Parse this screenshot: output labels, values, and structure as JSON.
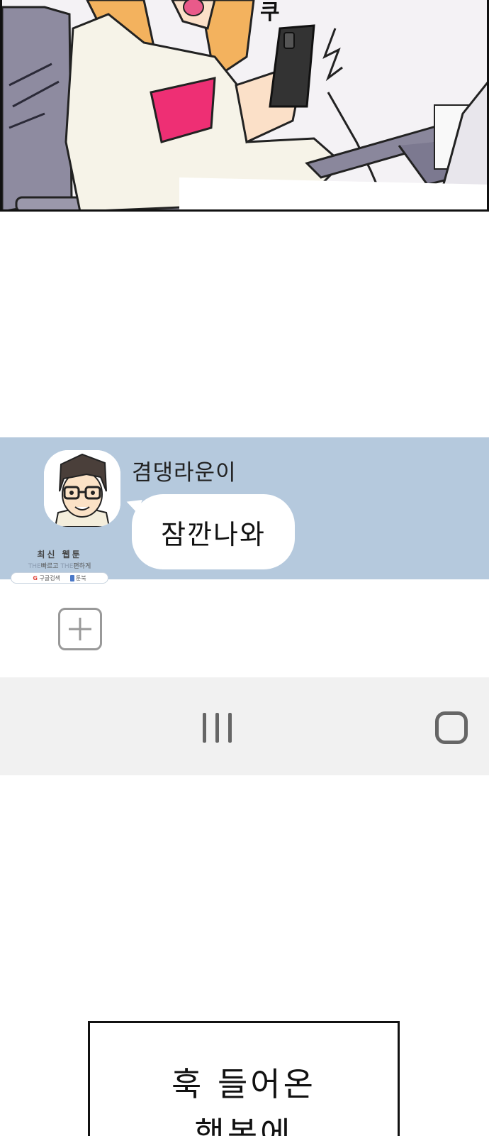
{
  "panel": {
    "sfx_text": "쿠"
  },
  "chat": {
    "sender_name": "겸댕라운이",
    "message": "잠깐나와"
  },
  "watermark": {
    "title": "최신 웹툰",
    "tagline_part1": "THE",
    "tagline_part2": "빠르고",
    "tagline_part3": "THE",
    "tagline_part4": "편하게",
    "google_label": "구글검색",
    "toonbook_label": "툰북"
  },
  "caption": {
    "line1": "훅 들어온",
    "line2": "행복에"
  },
  "colors": {
    "chat_bg": "#b5c9dd",
    "navbar_bg": "#f1f1f1",
    "shirt_pink": "#ee2f74"
  }
}
